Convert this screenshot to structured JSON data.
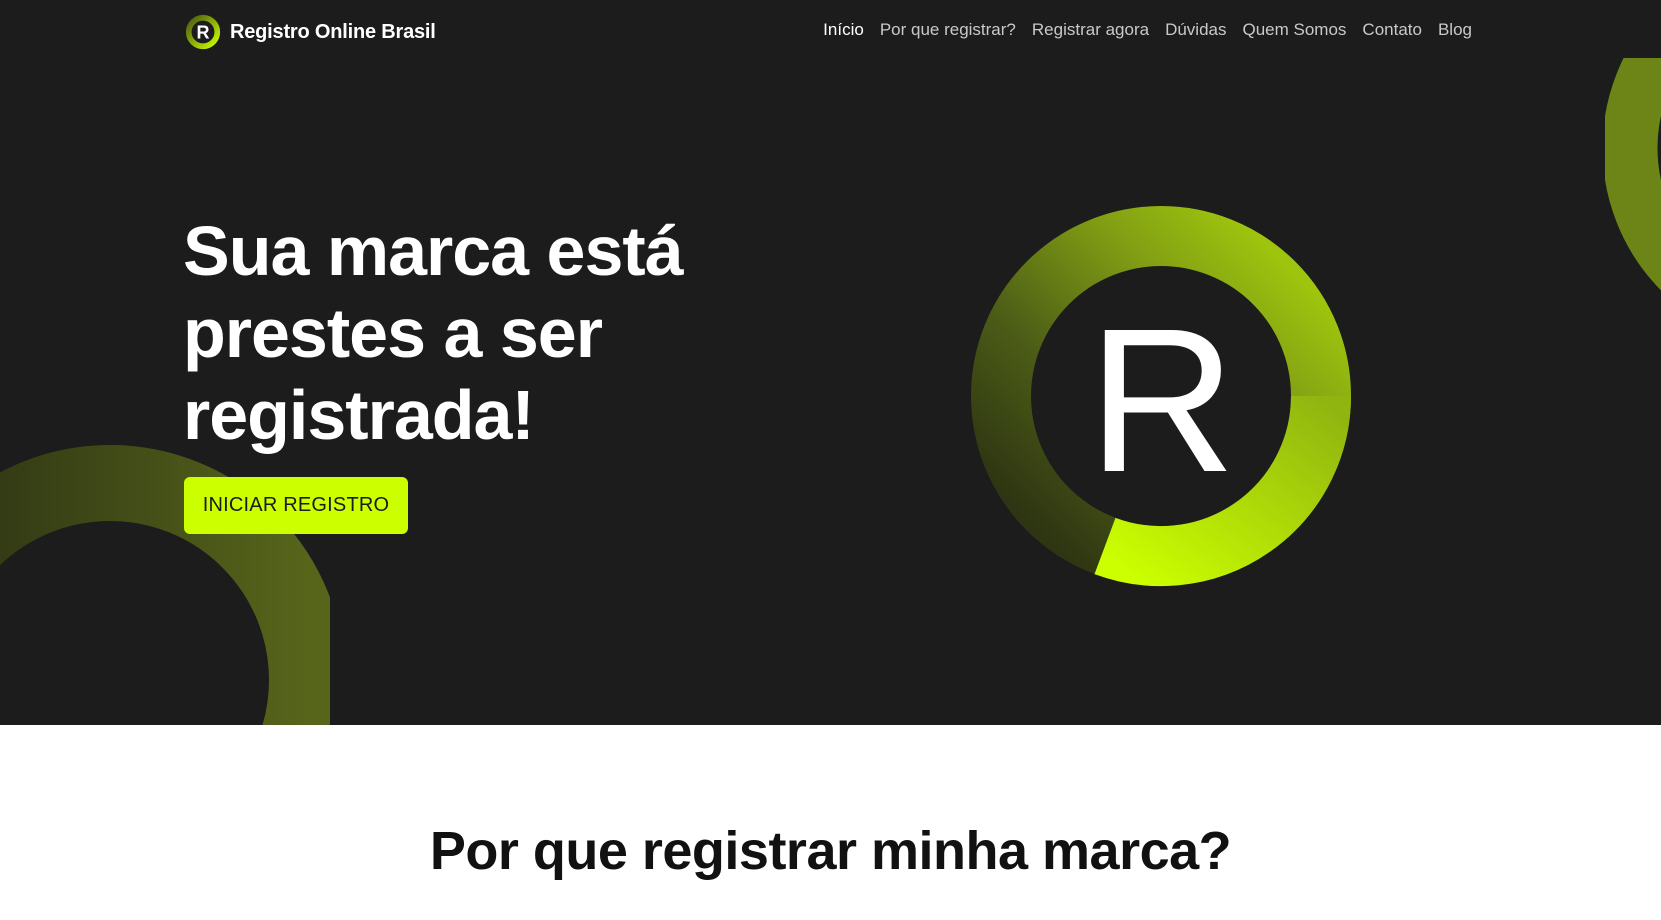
{
  "brand": {
    "logo_letter": "R",
    "name": "Registro Online Brasil"
  },
  "nav": {
    "items": [
      {
        "label": "Início",
        "active": true
      },
      {
        "label": "Por que registrar?",
        "active": false
      },
      {
        "label": "Registrar agora",
        "active": false
      },
      {
        "label": "Dúvidas",
        "active": false
      },
      {
        "label": "Quem Somos",
        "active": false
      },
      {
        "label": "Contato",
        "active": false
      },
      {
        "label": "Blog",
        "active": false
      }
    ]
  },
  "hero": {
    "headline_line1": "Sua marca está",
    "headline_line2": "prestes a ser",
    "headline_line3": "registrada!",
    "cta_label": "INICIAR REGISTRO",
    "emblem_letter": "R"
  },
  "section": {
    "title": "Por que registrar minha marca?"
  },
  "colors": {
    "hero_background": "#1c1c1c",
    "accent": "#ccff00",
    "ring_dark": "#3d4a10",
    "text_light": "#ffffff",
    "nav_text": "#c9c9c9"
  }
}
